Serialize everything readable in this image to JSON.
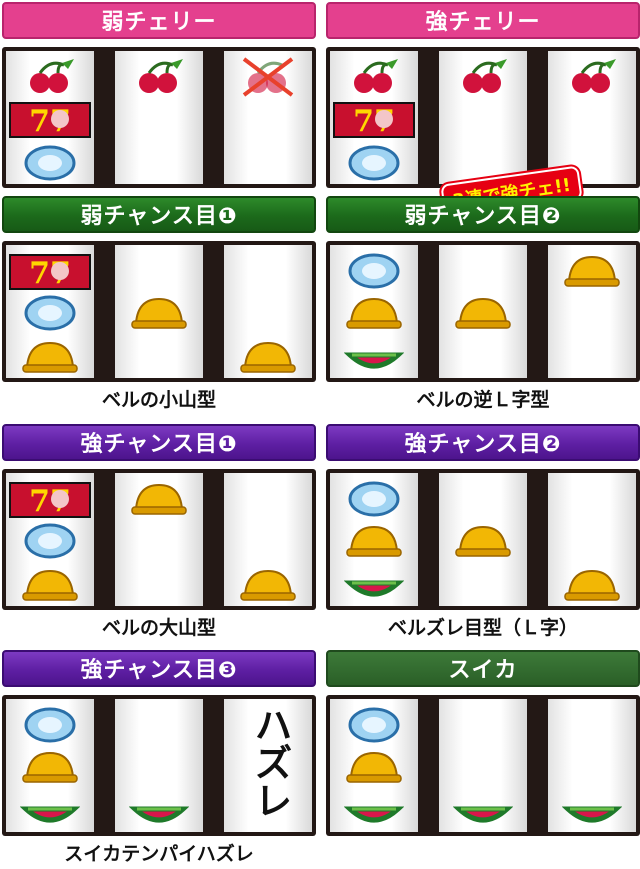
{
  "panels": [
    {
      "title": "弱チェリー",
      "caption": "",
      "reels": [
        [
          "cherry",
          "seven",
          "replay"
        ],
        [
          "cherry",
          "blank",
          "blank"
        ],
        [
          "cherry-crossed",
          "blank",
          "blank"
        ]
      ]
    },
    {
      "title": "強チェリー",
      "caption": "",
      "note": "3連で強チェ!!",
      "reels": [
        [
          "cherry",
          "seven",
          "replay"
        ],
        [
          "cherry",
          "blank",
          "blank"
        ],
        [
          "cherry",
          "blank",
          "blank"
        ]
      ]
    },
    {
      "title": "弱チャンス目❶",
      "caption": "ベルの小山型",
      "reels": [
        [
          "seven",
          "replay",
          "bell"
        ],
        [
          "blank",
          "bell",
          "blank"
        ],
        [
          "blank",
          "blank",
          "bell"
        ]
      ]
    },
    {
      "title": "弱チャンス目❷",
      "caption": "ベルの逆Ｌ字型",
      "reels": [
        [
          "replay",
          "bell",
          "watermelon"
        ],
        [
          "blank",
          "bell",
          "blank"
        ],
        [
          "bell",
          "blank",
          "blank"
        ]
      ]
    },
    {
      "title": "強チャンス目❶",
      "caption": "ベルの大山型",
      "reels": [
        [
          "seven",
          "replay",
          "bell"
        ],
        [
          "bell",
          "blank",
          "blank"
        ],
        [
          "blank",
          "blank",
          "bell"
        ]
      ]
    },
    {
      "title": "強チャンス目❷",
      "caption": "ベルズレ目型（Ｌ字）",
      "reels": [
        [
          "replay",
          "bell",
          "watermelon"
        ],
        [
          "blank",
          "bell",
          "blank"
        ],
        [
          "blank",
          "blank",
          "bell"
        ]
      ]
    },
    {
      "title": "強チャンス目❸",
      "caption": "スイカテンパイハズレ",
      "hazure": "ハズレ",
      "reels": [
        [
          "replay",
          "bell",
          "watermelon"
        ],
        [
          "blank",
          "blank",
          "watermelon"
        ],
        [
          "blank",
          "blank",
          "blank"
        ]
      ]
    },
    {
      "title": "スイカ",
      "caption": "",
      "reels": [
        [
          "replay",
          "bell",
          "watermelon"
        ],
        [
          "blank",
          "blank",
          "watermelon"
        ],
        [
          "blank",
          "blank",
          "watermelon"
        ]
      ]
    }
  ],
  "colors": {
    "pink": "#e4408e",
    "green": "#1c6a1b",
    "purple": "#5e1fa3",
    "reel_frame": "#231815"
  }
}
